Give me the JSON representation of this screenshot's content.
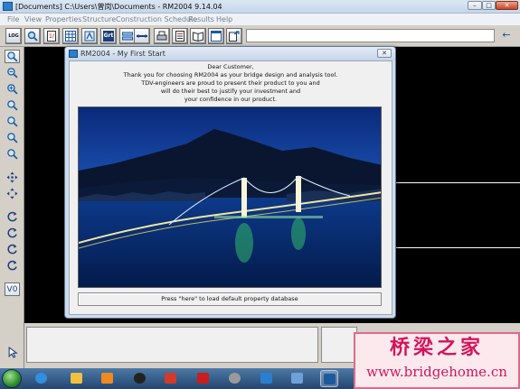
{
  "window": {
    "title": "[Documents] C:\\Users\\曾岗\\Documents - RM2004 9.14.04",
    "min_label": "–",
    "max_label": "□",
    "close_label": "✕"
  },
  "menu": {
    "items": [
      {
        "label": "File"
      },
      {
        "label": "View"
      },
      {
        "label": "Properties"
      },
      {
        "label": "Structure"
      },
      {
        "label": "Construction Schedule"
      },
      {
        "label": "Results"
      },
      {
        "label": "Help"
      }
    ]
  },
  "toolbar": {
    "log_label": "LOG",
    "grid_label": "Grt",
    "back_glyph": "←"
  },
  "left_tools": {
    "v0_label": "V0"
  },
  "dialog": {
    "title": "RM2004 - My First Start",
    "close_label": "✕",
    "message_lines": [
      "Dear Customer,",
      "Thank you for choosing RM2004 as your bridge design and analysis tool.",
      "TDV-engineers are proud to present their product to you and",
      "will do their best to justify your investment and",
      "your confidence in our product."
    ],
    "load_text": "Press \"here\" to load default property database"
  },
  "watermark": {
    "cn": "桥梁之家",
    "url": "www.bridgehome.cn"
  },
  "colors": {
    "workspace": "#000000",
    "accent": "#2c7fc9",
    "watermark": "#d4145a"
  }
}
